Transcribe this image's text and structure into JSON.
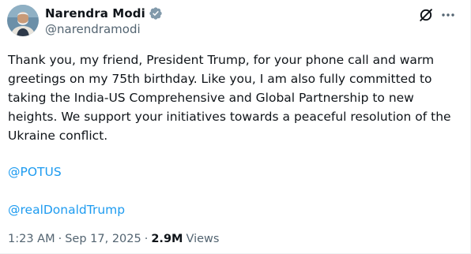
{
  "author": {
    "name": "Narendra Modi",
    "handle": "@narendramodi",
    "verified_color": "#829aab"
  },
  "icons": {
    "grok": "grok-icon",
    "more": "more-horizontal-icon"
  },
  "tweet": {
    "text": "Thank you, my friend, President Trump, for your phone call and warm\ngreetings on my 75th birthday. Like you, I am also fully committed to\ntaking the India-US Comprehensive and Global Partnership to new\nheights. We support your initiatives towards a peaceful resolution of the\nUkraine conflict.",
    "mentions": [
      "@POTUS",
      "@realDonaldTrump"
    ],
    "link_color": "#1d9bf0"
  },
  "meta": {
    "time": "1:23 AM",
    "separator": "·",
    "date": "Sep 17, 2025",
    "views_count": "2.9M",
    "views_label": "Views"
  }
}
